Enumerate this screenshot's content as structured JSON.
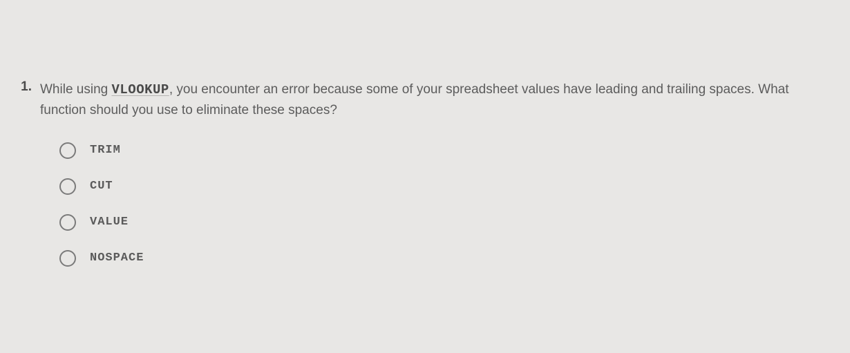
{
  "question": {
    "number": "1.",
    "text_before": "While using ",
    "code_word": "VLOOKUP",
    "text_after": ", you encounter an error because some of your spreadsheet values have leading and trailing spaces. What function should you use to eliminate these spaces?"
  },
  "options": [
    {
      "label": "TRIM"
    },
    {
      "label": "CUT"
    },
    {
      "label": "VALUE"
    },
    {
      "label": "NOSPACE"
    }
  ]
}
